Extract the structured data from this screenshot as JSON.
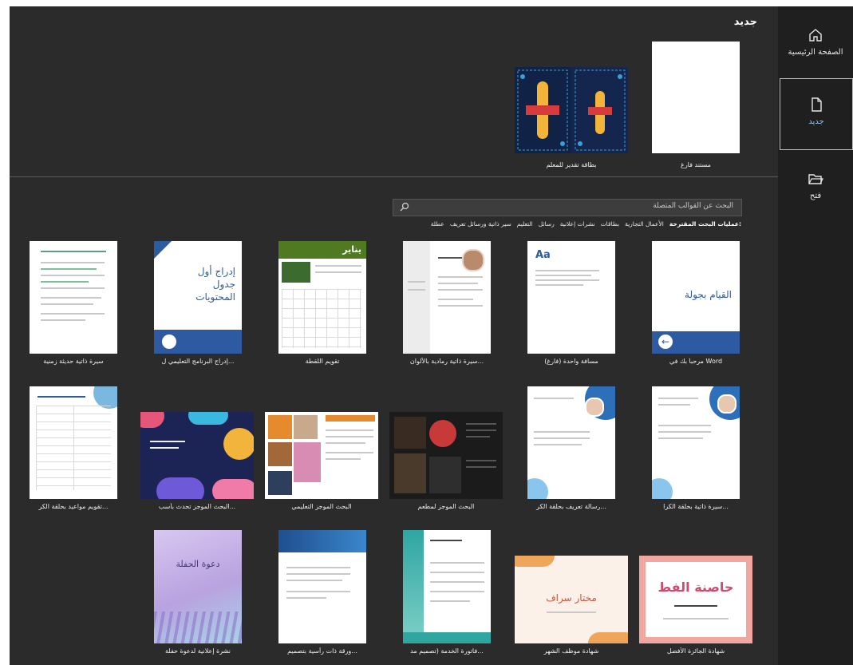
{
  "page": {
    "title": "جديد"
  },
  "nav": {
    "home": "الصفحة الرئيسية",
    "new": "جديد",
    "open": "فتح"
  },
  "featured": [
    {
      "label": "مستند فارغ"
    },
    {
      "label": "بطاقة تقدير للمعلم"
    }
  ],
  "search": {
    "placeholder": "البحث عن القوالب المتصلة"
  },
  "suggestions": {
    "lead": "عمليات البحث المقترحة:",
    "items": [
      "الأعمال التجارية",
      "بطاقات",
      "نشرات إعلانية",
      "رسائل",
      "التعليم",
      "سير ذاتية ورسائل تعريف",
      "عطلة"
    ]
  },
  "templates": [
    {
      "label": "مرحباً بك في Word",
      "thumb_text": "القيام بجولة"
    },
    {
      "label": "مسافة واحدة (فارغ)",
      "thumb_text": "Aa"
    },
    {
      "label": "سيرة ذاتية رمادية بالألوان...",
      "thumb_text": ""
    },
    {
      "label": "تقويم اللقطة",
      "thumb_text": "يناير"
    },
    {
      "label": "إدراج البرنامج التعليمي ل...",
      "thumb_text": "إدراج أول جدول المحتويات"
    },
    {
      "label": "سيرة ذاتية حديثة زمنية",
      "thumb_text": ""
    },
    {
      "label": "سيرة ذاتية بحلقة الكرا...",
      "thumb_text": ""
    },
    {
      "label": "رسالة تعريف بحلقة الكر...",
      "thumb_text": ""
    },
    {
      "label": "البحث الموجز لمطعم",
      "thumb_text": ""
    },
    {
      "label": "البحث الموجز التعليمي",
      "thumb_text": ""
    },
    {
      "label": "البحث الموجز تحدث بأسب...",
      "thumb_text": ""
    },
    {
      "label": "تقويم مواعيد بحلقة الكر...",
      "thumb_text": ""
    },
    {
      "label": "شهادة الجائزة الأفضل",
      "thumb_text": "حاصنة الفط"
    },
    {
      "label": "شهادة موظف الشهر",
      "thumb_text": "مختار سراف"
    },
    {
      "label": "فاتورة الخدمة (تصميم مد...",
      "thumb_text": ""
    },
    {
      "label": "ورقة ذات رأسية بتصميم...",
      "thumb_text": ""
    },
    {
      "label": "نشرة إعلانية لدعوة حفلة",
      "thumb_text": "دعوة الحفلة"
    }
  ],
  "colors": {
    "bg": "#2b2b2b",
    "nav": "#1f1f1f",
    "accent": "#2d5aa0"
  }
}
